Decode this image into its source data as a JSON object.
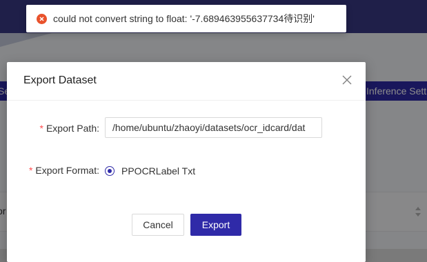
{
  "background": {
    "bar_left_text": "Se",
    "bar_right_text": "Inference Sett",
    "table_left_text": "or"
  },
  "toast": {
    "type": "error",
    "icon": "error-circle-icon",
    "message": "could not convert string to float: '-7.689463955637734待识别'"
  },
  "dialog": {
    "title": "Export Dataset",
    "close_icon": "close-icon",
    "fields": {
      "export_path": {
        "label": "Export Path",
        "value": "/home/ubuntu/zhaoyi/datasets/ocr_idcard/dat"
      },
      "export_format": {
        "label": "Export Format",
        "options": [
          "PPOCRLabel Txt"
        ],
        "selected": "PPOCRLabel Txt"
      }
    },
    "buttons": {
      "cancel": "Cancel",
      "export": "Export"
    }
  },
  "colors": {
    "primary": "#2f2aa8",
    "header": "#3a3a86",
    "error": "#e9522c",
    "required": "#ff4d4f"
  }
}
